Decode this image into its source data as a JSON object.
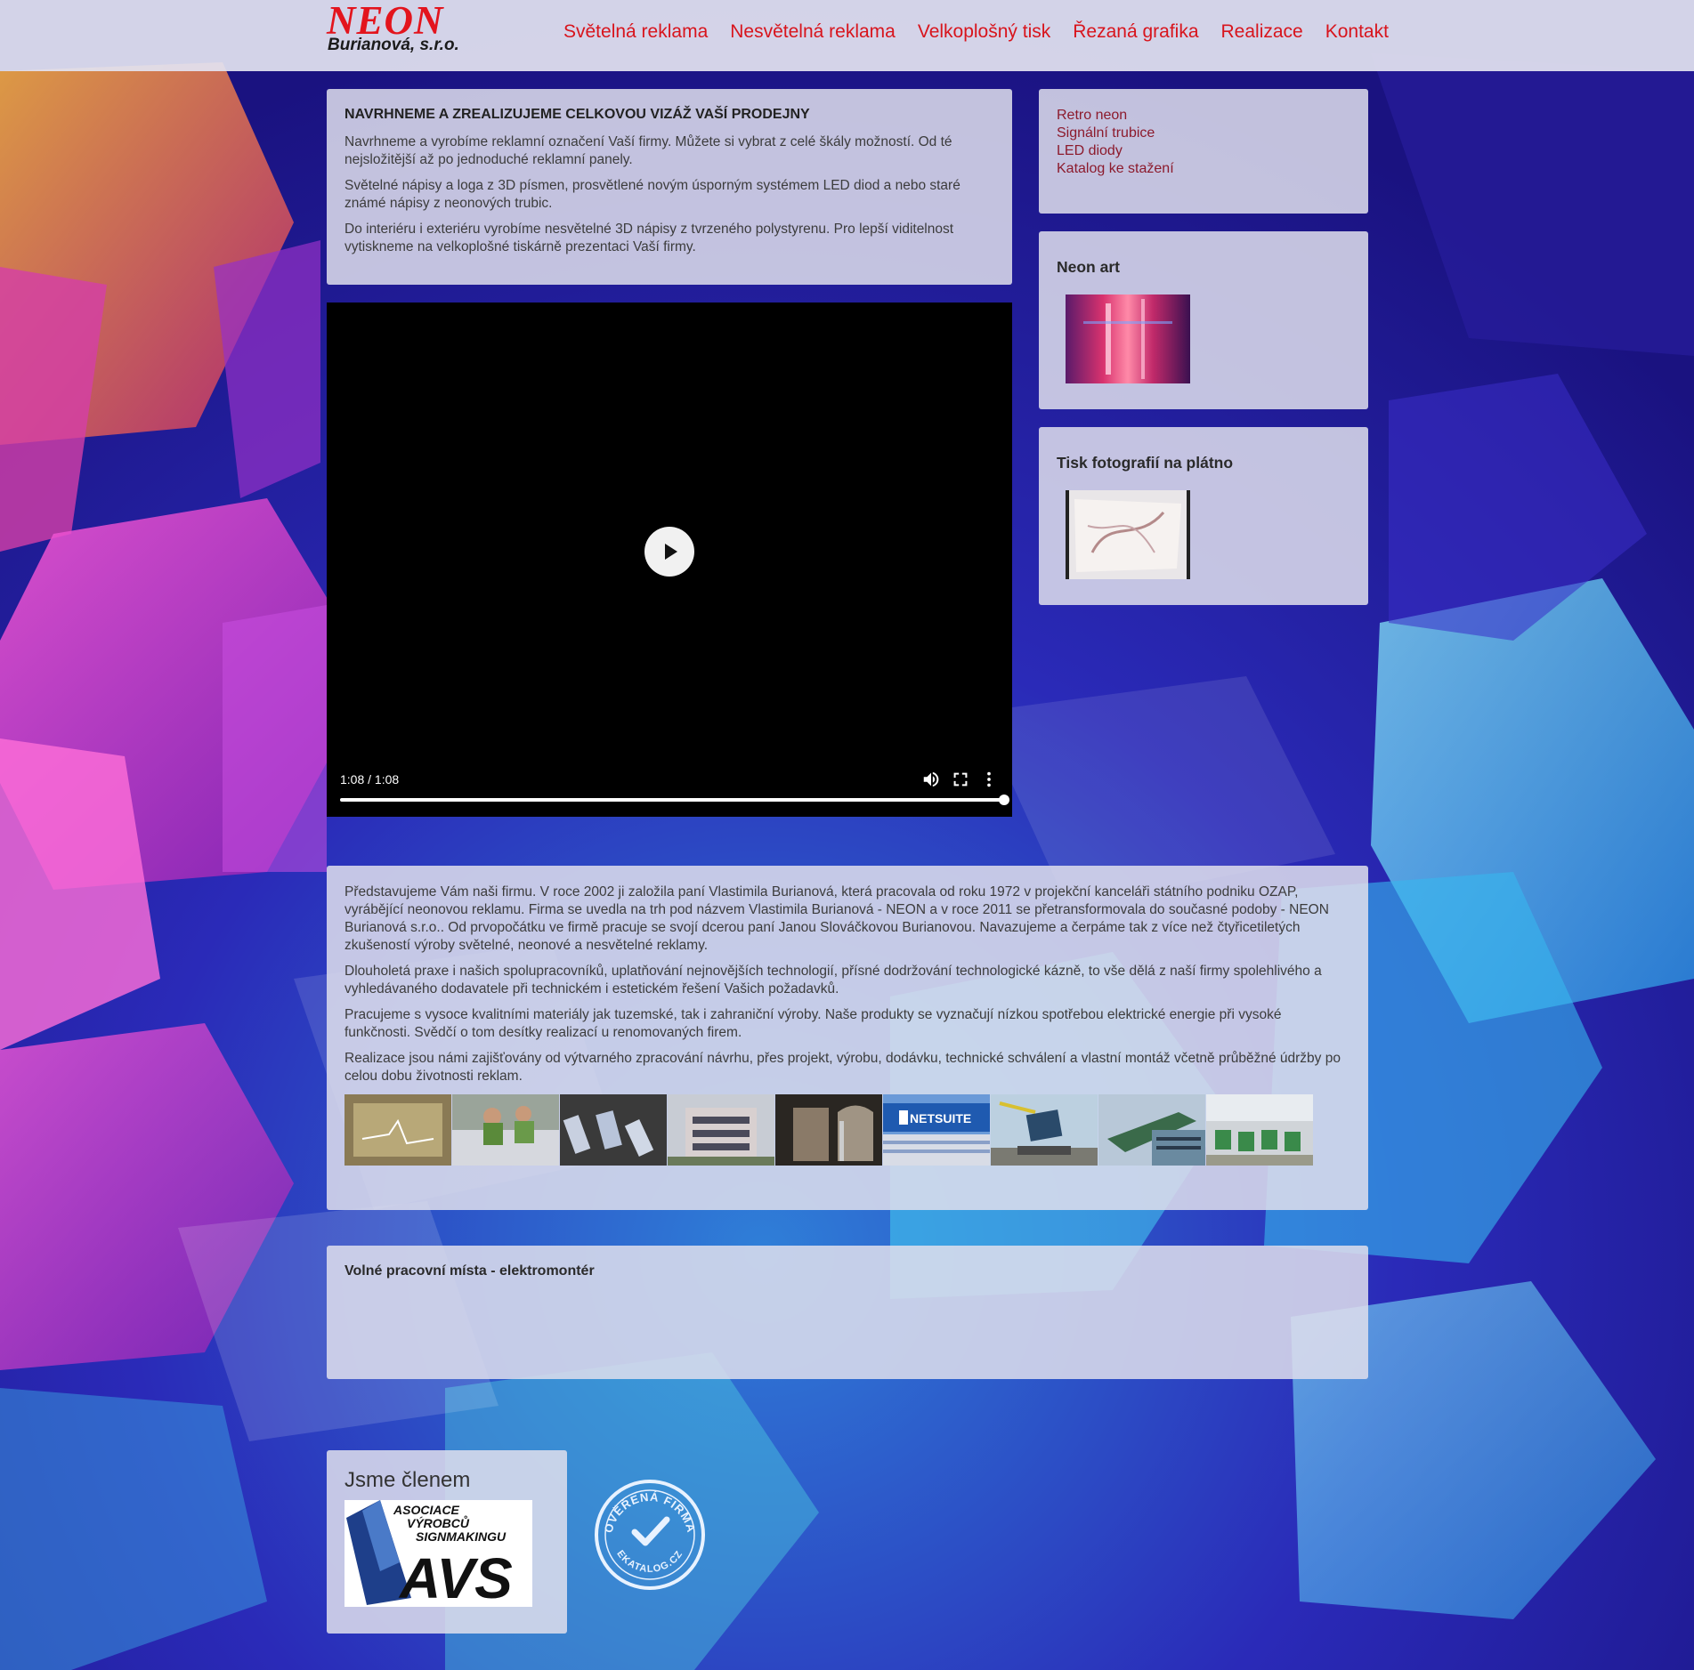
{
  "colors": {
    "accent": "#d8141c",
    "link": "#8c1a2c",
    "panel": "rgba(222,222,236,0.86)",
    "header": "rgba(226,226,240,0.93)"
  },
  "header": {
    "logo_main": "NEON",
    "logo_sub": "Burianová, s.r.o.",
    "nav": [
      "Světelná reklama",
      "Nesvětelná reklama",
      "Velkoplošný tisk",
      "Řezaná grafika",
      "Realizace",
      "Kontakt"
    ]
  },
  "intro": {
    "title": "NAVRHNEME A ZREALIZUJEME CELKOVOU VIZÁŽ VAŠÍ PRODEJNY",
    "paragraphs": [
      "Navrhneme a vyrobíme reklamní označení Vaší firmy. Můžete si vybrat z celé škály možností. Od té nejsložitější až po jednoduché reklamní panely.",
      "Světelné nápisy a loga z 3D písmen, prosvětlené novým úsporným systémem LED diod a nebo staré známé nápisy z neonových trubic.",
      "Do interiéru i exteriéru vyrobíme nesvětelné 3D nápisy z tvrzeného polystyrenu. Pro lepší viditelnost vytiskneme na velkoplošné tiskárně prezentaci Vaší firmy."
    ]
  },
  "video": {
    "time": "1:08 / 1:08",
    "progress": 1.0,
    "icons": [
      "play-icon",
      "volume-icon",
      "fullscreen-icon",
      "more-options-icon"
    ]
  },
  "sidebar": {
    "links": [
      "Retro neon",
      "Signální trubice",
      "LED diody",
      "Katalog ke stažení"
    ],
    "neon_art_title": "Neon art",
    "canvas_title": "Tisk fotografií na plátno"
  },
  "about": {
    "paragraphs": [
      "Představujeme Vám naši firmu. V roce 2002 ji založila paní Vlastimila Burianová, která pracovala od roku 1972 v projekční kanceláři státního podniku OZAP, vyrábějící neonovou reklamu. Firma se uvedla na trh pod názvem Vlastimila Burianová - NEON a v roce 2011 se přetransformovala do současné podoby - NEON Burianová s.r.o.. Od prvopočátku ve firmě pracuje se svojí dcerou paní Janou Slováčkovou Burianovou. Navazujeme a čerpáme tak z více než čtyřicetiletých zkušeností výroby světelné, neonové a nesvětelné reklamy.",
      "Dlouholetá praxe i našich spolupracovníků, uplatňování nejnovějších technologií, přísné dodržování technologické kázně, to vše dělá z naší firmy spolehlivého a vyhledávaného dodavatele při technickém i estetickém řešení Vašich požadavků.",
      "Pracujeme s vysoce kvalitními materiály jak tuzemské, tak i zahraniční výroby. Naše produkty se vyznačují nízkou spotřebou elektrické energie při vysoké funkčnosti. Svědčí o tom desítky realizací u renomovaných firem.",
      "Realizace jsou námi zajišťovány od výtvarného zpracování návrhu, přes projekt, výrobu, dodávku, technické schválení a vlastní montáž včetně průběžné údržby po celou dobu životnosti reklam."
    ],
    "gallery_sign_text": "NETSUITE"
  },
  "jobs": {
    "title": "Volné pracovní místa - elektromontér"
  },
  "member": {
    "title": "Jsme členem",
    "avs_lines": [
      "ASOCIACE",
      "VÝROBCŮ",
      "SIGNMAKINGU"
    ],
    "avs_logo": "AVS",
    "stamp_top": "OVĚŘENÁ FIRMA",
    "stamp_bottom": "EKATALOG.CZ"
  }
}
